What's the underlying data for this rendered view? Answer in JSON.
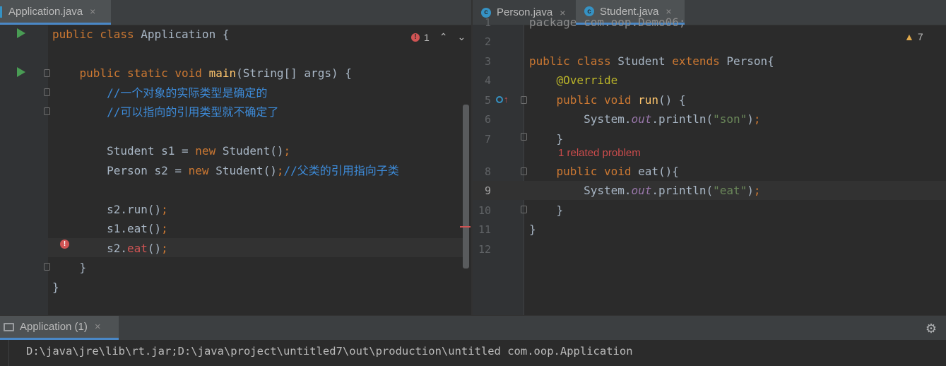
{
  "left_editor": {
    "tab": {
      "label": "Application.java",
      "close": "×"
    },
    "inspection": {
      "count": "1"
    },
    "lines": [
      [
        {
          "t": "public class ",
          "c": "kw"
        },
        {
          "t": "Application ",
          "c": ""
        },
        {
          "t": "{",
          "c": ""
        }
      ],
      [],
      [
        {
          "t": "    public static void ",
          "c": "kw"
        },
        {
          "t": "main",
          "c": "fn"
        },
        {
          "t": "(String[] args) {",
          "c": ""
        }
      ],
      [
        {
          "t": "        //一个对象的实际类型是确定的",
          "c": "cm"
        }
      ],
      [
        {
          "t": "        //可以指向的引用类型就不确定了",
          "c": "cm"
        }
      ],
      [],
      [
        {
          "t": "        Student s1 = ",
          "c": ""
        },
        {
          "t": "new ",
          "c": "kw"
        },
        {
          "t": "Student()",
          "c": ""
        },
        {
          "t": ";",
          "c": "kw"
        }
      ],
      [
        {
          "t": "        Person s2 = ",
          "c": ""
        },
        {
          "t": "new ",
          "c": "kw"
        },
        {
          "t": "Student()",
          "c": ""
        },
        {
          "t": ";",
          "c": "kw"
        },
        {
          "t": "//父类的引用指向子类",
          "c": "cm"
        }
      ],
      [],
      [
        {
          "t": "        s2.run()",
          "c": ""
        },
        {
          "t": ";",
          "c": "kw"
        }
      ],
      [
        {
          "t": "        s1.eat()",
          "c": ""
        },
        {
          "t": ";",
          "c": "kw"
        }
      ],
      [
        {
          "t": "        s2.",
          "c": ""
        },
        {
          "t": "eat",
          "c": "err-call"
        },
        {
          "t": "()",
          "c": ""
        },
        {
          "t": ";",
          "c": "kw"
        }
      ],
      [
        {
          "t": "    }",
          "c": ""
        }
      ],
      [
        {
          "t": "}",
          "c": ""
        }
      ]
    ]
  },
  "right_editor": {
    "tabs": [
      {
        "label": "Person.java",
        "close": "×"
      },
      {
        "label": "Student.java",
        "close": "×"
      }
    ],
    "inspection": {
      "count": "7"
    },
    "line_numbers": [
      "1",
      "2",
      "3",
      "4",
      "5",
      "6",
      "7",
      "8",
      "9",
      "10",
      "11",
      "12"
    ],
    "partial_line": "package com.oop.Demo06;",
    "lines": [
      [],
      [
        {
          "t": "public class ",
          "c": "kw"
        },
        {
          "t": "Student ",
          "c": ""
        },
        {
          "t": "extends ",
          "c": "kw"
        },
        {
          "t": "Person{",
          "c": ""
        }
      ],
      [
        {
          "t": "    @Override",
          "c": "ann"
        }
      ],
      [
        {
          "t": "    public void ",
          "c": "kw"
        },
        {
          "t": "run",
          "c": "fn"
        },
        {
          "t": "() {",
          "c": ""
        }
      ],
      [
        {
          "t": "        System.",
          "c": ""
        },
        {
          "t": "out",
          "c": "ital"
        },
        {
          "t": ".println(",
          "c": ""
        },
        {
          "t": "\"son\"",
          "c": "str"
        },
        {
          "t": ")",
          "c": ""
        },
        {
          "t": ";",
          "c": "kw"
        }
      ],
      [
        {
          "t": "    }",
          "c": ""
        }
      ],
      [
        {
          "t": "    public void ",
          "c": "kw"
        },
        {
          "t": "eat",
          "c": "fn-dim"
        },
        {
          "t": "(){",
          "c": ""
        }
      ],
      [
        {
          "t": "        System.",
          "c": ""
        },
        {
          "t": "out",
          "c": "ital"
        },
        {
          "t": ".println(",
          "c": ""
        },
        {
          "t": "\"eat\"",
          "c": "str"
        },
        {
          "t": ")",
          "c": ""
        },
        {
          "t": ";",
          "c": "kw"
        }
      ],
      [
        {
          "t": "    }",
          "c": ""
        }
      ],
      [
        {
          "t": "}",
          "c": ""
        }
      ],
      []
    ],
    "related_problem": "1 related problem"
  },
  "run_panel": {
    "tab_label": "Application (1)",
    "close": "×",
    "console_text": "D:\\java\\jre\\lib\\rt.jar;D:\\java\\project\\untitled7\\out\\production\\untitled com.oop.Application"
  },
  "colors": {
    "keyword": "#cc7832",
    "function": "#ffc66d",
    "comment": "#3d8bd9",
    "string": "#6a8759",
    "annotation": "#bbb529",
    "static_field": "#9876aa",
    "error": "#d05454",
    "accent": "#4a88c7"
  }
}
